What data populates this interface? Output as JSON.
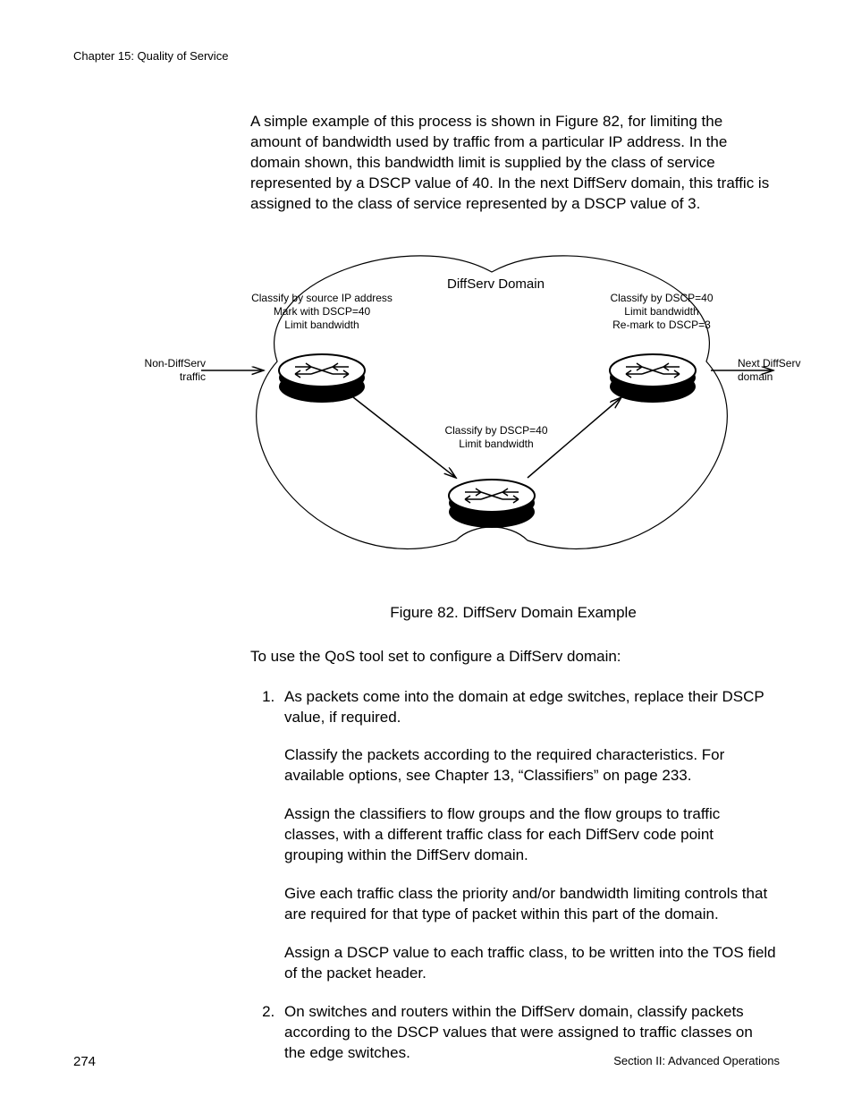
{
  "header": {
    "chapter": "Chapter 15: Quality of Service"
  },
  "intro": "A simple example of this process is shown in Figure 82, for limiting the amount of bandwidth used by traffic from a particular IP address. In the domain shown, this bandwidth limit is supplied by the class of service represented by a DSCP value of 40. In the next DiffServ domain, this traffic is assigned to the class of service represented by a DSCP value of 3.",
  "figure": {
    "title": "DiffServ Domain",
    "caption": "Figure 82. DiffServ Domain Example",
    "left_in": {
      "l1": "Non-DiffServ",
      "l2": "traffic"
    },
    "right_out": {
      "l1": "Next DiffServ",
      "l2": "domain"
    },
    "node_left": {
      "l1": "Classify by source IP address",
      "l2": "Mark with DSCP=40",
      "l3": "Limit bandwidth"
    },
    "node_right": {
      "l1": "Classify by DSCP=40",
      "l2": "Limit bandwidth",
      "l3": "Re-mark to DSCP=3"
    },
    "node_mid": {
      "l1": "Classify by DSCP=40",
      "l2": "Limit bandwidth"
    }
  },
  "lead": "To use the QoS tool set to configure a DiffServ domain:",
  "steps": {
    "s1": {
      "p1": "As packets come into the domain at edge switches, replace their DSCP value, if required.",
      "p2": "Classify the packets according to the required characteristics. For available options, see Chapter 13, “Classifiers” on page 233.",
      "p3": "Assign the classifiers to flow groups and the flow groups to traffic classes, with a different traffic class for each DiffServ code point grouping within the DiffServ domain.",
      "p4": "Give each traffic class the priority and/or bandwidth limiting controls that are required for that type of packet within this part of the domain.",
      "p5": "Assign a DSCP value to each traffic class, to be written into the TOS field of the packet header."
    },
    "s2": {
      "p1": "On switches and routers within the DiffServ domain, classify packets according to the DSCP values that were assigned to traffic classes on the edge switches."
    }
  },
  "footer": {
    "page": "274",
    "section": "Section II: Advanced Operations"
  }
}
